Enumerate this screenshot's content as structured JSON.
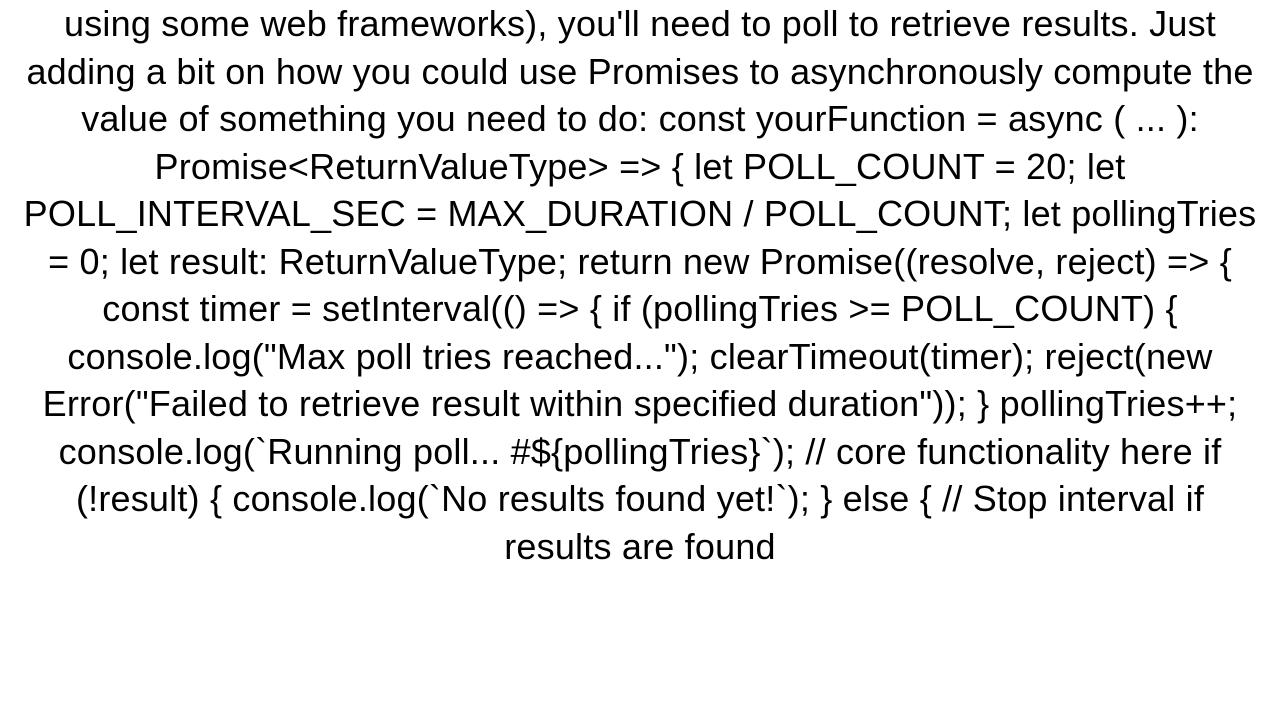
{
  "document": {
    "body_text": "using some web frameworks), you'll need to poll to retrieve results. Just adding a bit on how you could use Promises to asynchronously compute the value of something you need to do: const yourFunction = async (   ... ): Promise<ReturnValueType> => {   let POLL_COUNT = 20;   let POLL_INTERVAL_SEC = MAX_DURATION / POLL_COUNT;   let pollingTries = 0;   let result: ReturnValueType;    return new Promise((resolve, reject) => {     const timer = setInterval(() => {       if (pollingTries >= POLL_COUNT) {         console.log(\"Max poll tries reached...\");         clearTimeout(timer);         reject(new Error(\"Failed to retrieve result within specified duration\"));       }        pollingTries++;       console.log(`Running poll... #${pollingTries}`);              // core functionality here        if (!result) {         console.log(`No results found yet!`);       } else {         // Stop interval if results are found"
  }
}
